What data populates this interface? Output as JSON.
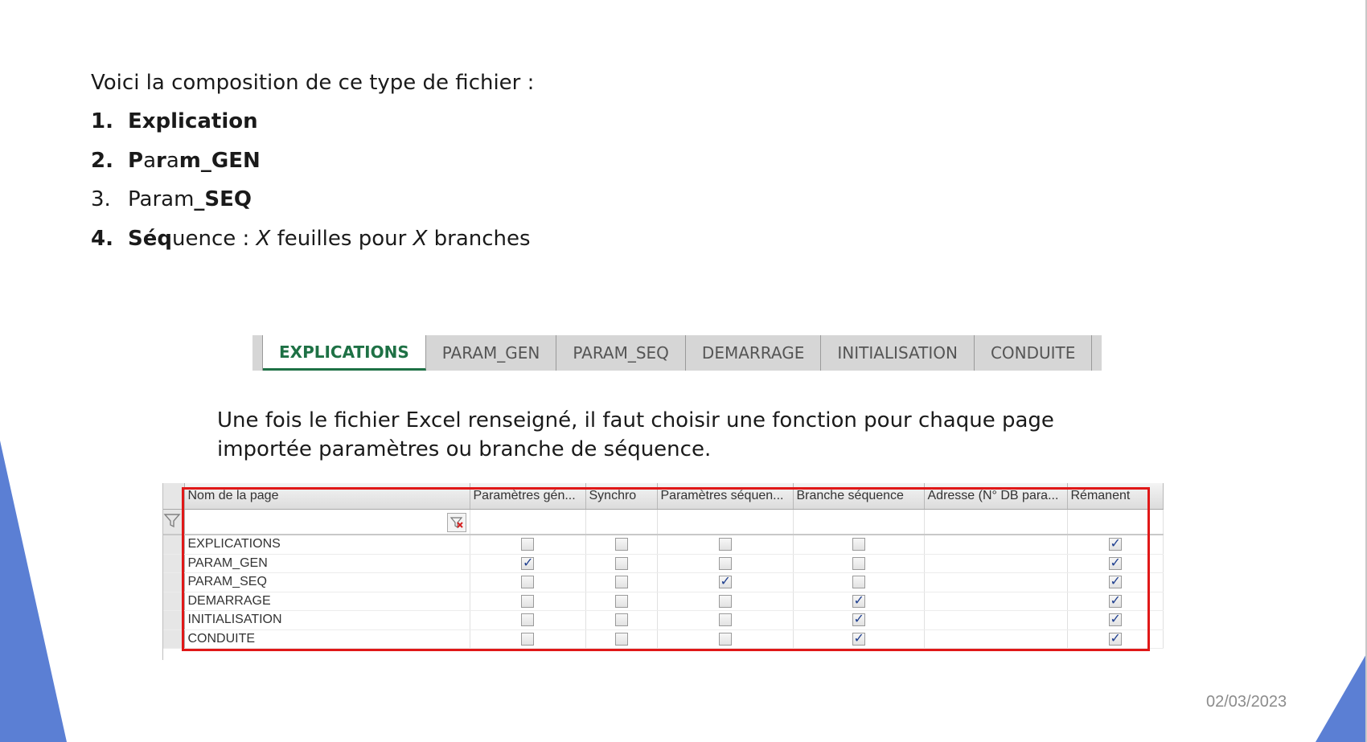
{
  "slide": {
    "intro": "Voici la composition de ce type de fichier :",
    "items": [
      {
        "num": "1.",
        "parts": [
          {
            "t": "Explication",
            "b": true
          }
        ]
      },
      {
        "num": "2.",
        "parts": [
          {
            "t": "P",
            "b": true
          },
          {
            "t": "a"
          },
          {
            "t": "r",
            "b": true
          },
          {
            "t": "a"
          },
          {
            "t": "m_GEN",
            "b": true
          }
        ]
      },
      {
        "num": "3.",
        "num_plain": true,
        "parts": [
          {
            "t": "Param"
          },
          {
            "t": "_SEQ",
            "b": true
          }
        ]
      },
      {
        "num": "4.",
        "parts": [
          {
            "t": "Séq",
            "b": true
          },
          {
            "t": "uence : "
          },
          {
            "t": "X",
            "i": true
          },
          {
            "t": " feuilles pour "
          },
          {
            "t": "X",
            "i": true
          },
          {
            "t": " branches"
          }
        ]
      }
    ],
    "paragraph": "Une fois le fichier Excel renseigné, il faut choisir une fonction pour chaque page importée paramètres ou branche de séquence.",
    "date": "02/03/2023",
    "accent_color": "#5b7fd4"
  },
  "sheet_tabs": {
    "active": "EXPLICATIONS",
    "tabs": [
      "EXPLICATIONS",
      "PARAM_GEN",
      "PARAM_SEQ",
      "DEMARRAGE",
      "INITIALISATION",
      "CONDUITE"
    ],
    "active_color": "#1e7145"
  },
  "grid": {
    "columns": [
      "Nom de la page",
      "Paramètres gén...",
      "Synchro",
      "Paramètres séquen...",
      "Branche séquence",
      "Adresse (N° DB para...",
      "Rémanent"
    ],
    "rows": [
      {
        "name": "EXPLICATIONS",
        "gen": false,
        "synchro": false,
        "seq": false,
        "branche": false,
        "adresse": "",
        "remanent": true
      },
      {
        "name": "PARAM_GEN",
        "gen": true,
        "synchro": false,
        "seq": false,
        "branche": false,
        "adresse": "",
        "remanent": true
      },
      {
        "name": "PARAM_SEQ",
        "gen": false,
        "synchro": false,
        "seq": true,
        "branche": false,
        "adresse": "",
        "remanent": true
      },
      {
        "name": "DEMARRAGE",
        "gen": false,
        "synchro": false,
        "seq": false,
        "branche": true,
        "adresse": "",
        "remanent": true
      },
      {
        "name": "INITIALISATION",
        "gen": false,
        "synchro": false,
        "seq": false,
        "branche": true,
        "adresse": "",
        "remanent": true
      },
      {
        "name": "CONDUITE",
        "gen": false,
        "synchro": false,
        "seq": false,
        "branche": true,
        "adresse": "",
        "remanent": true
      }
    ],
    "highlight_color": "#e01818"
  }
}
